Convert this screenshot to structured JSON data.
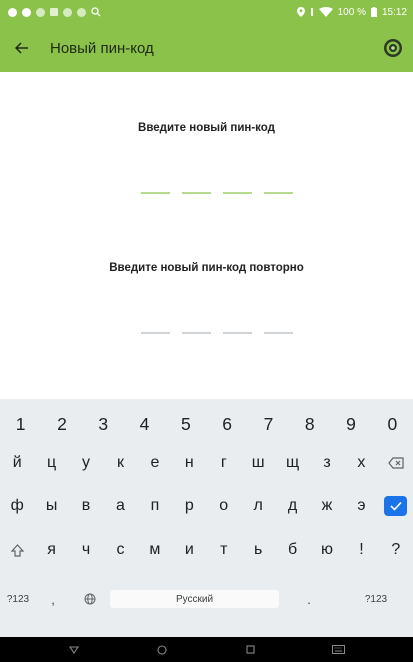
{
  "status_bar": {
    "battery_percent": "100 %",
    "time": "15:12"
  },
  "app_bar": {
    "title": "Новый пин-код"
  },
  "pin_entry": {
    "prompt_new": "Введите новый пин-код",
    "prompt_repeat": "Введите новый пин-код повторно",
    "digits_per_code": 4
  },
  "keyboard": {
    "number_row": [
      "1",
      "2",
      "3",
      "4",
      "5",
      "6",
      "7",
      "8",
      "9",
      "0"
    ],
    "row1": [
      "й",
      "ц",
      "у",
      "к",
      "е",
      "н",
      "г",
      "ш",
      "щ",
      "з",
      "х"
    ],
    "row2": [
      "ф",
      "ы",
      "в",
      "а",
      "п",
      "р",
      "о",
      "л",
      "д",
      "ж",
      "э"
    ],
    "row3": [
      "я",
      "ч",
      "с",
      "м",
      "и",
      "т",
      "ь",
      "б",
      "ю",
      "!",
      "?"
    ],
    "symbols_label": "?123",
    "comma": ",",
    "space_label": "Русский",
    "period": ".",
    "symbols_label_right": "?123"
  },
  "colors": {
    "accent": "#8bc34a",
    "keyboard_bg": "#e9edf0",
    "enter_blue": "#1a73e8"
  }
}
